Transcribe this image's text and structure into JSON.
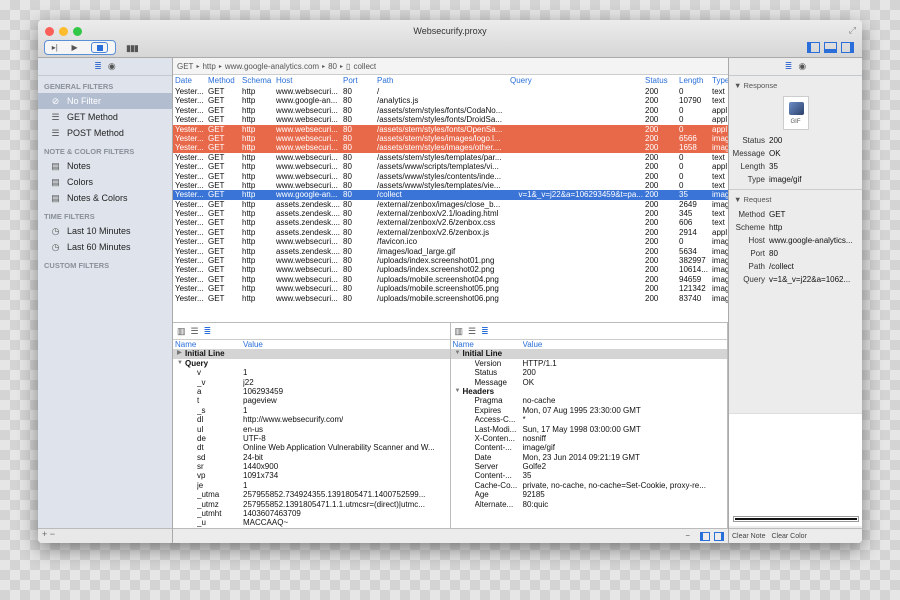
{
  "window": {
    "title": "Websecurify.proxy"
  },
  "sidebar": {
    "sections": [
      {
        "title": "GENERAL FILTERS",
        "items": [
          {
            "label": "No Filter",
            "icon": "no-filter-icon",
            "selected": true
          },
          {
            "label": "GET Method",
            "icon": "list-icon"
          },
          {
            "label": "POST Method",
            "icon": "list-icon"
          }
        ]
      },
      {
        "title": "NOTE & COLOR FILTERS",
        "items": [
          {
            "label": "Notes",
            "icon": "note-icon"
          },
          {
            "label": "Colors",
            "icon": "note-icon"
          },
          {
            "label": "Notes & Colors",
            "icon": "note-icon"
          }
        ]
      },
      {
        "title": "TIME FILTERS",
        "items": [
          {
            "label": "Last 10 Minutes",
            "icon": "clock-icon"
          },
          {
            "label": "Last 60 Minutes",
            "icon": "clock-icon"
          }
        ]
      },
      {
        "title": "CUSTOM FILTERS",
        "items": []
      }
    ],
    "footer": "+ −"
  },
  "breadcrumb": [
    "GET",
    "http",
    "www.google-analytics.com",
    "80",
    "collect"
  ],
  "table": {
    "columns": [
      "Date",
      "Method",
      "Schema",
      "Host",
      "Port",
      "Path",
      "Query",
      "Status",
      "Length",
      "Type"
    ],
    "rows": [
      [
        "Yester...",
        "GET",
        "http",
        "www.websecuri...",
        "80",
        "/",
        "",
        "200",
        "0",
        "text",
        "none"
      ],
      [
        "Yester...",
        "GET",
        "http",
        "www.google-an...",
        "80",
        "/analytics.js",
        "",
        "200",
        "10790",
        "text",
        "none"
      ],
      [
        "Yester...",
        "GET",
        "http",
        "www.websecuri...",
        "80",
        "/assets/stem/styles/fonts/CodaNo...",
        "",
        "200",
        "0",
        "appl",
        "none"
      ],
      [
        "Yester...",
        "GET",
        "http",
        "www.websecuri...",
        "80",
        "/assets/stem/styles/fonts/DroidSa...",
        "",
        "200",
        "0",
        "appl",
        "none"
      ],
      [
        "Yester...",
        "GET",
        "http",
        "www.websecuri...",
        "80",
        "/assets/stem/styles/fonts/OpenSa...",
        "",
        "200",
        "0",
        "appl",
        "red"
      ],
      [
        "Yester...",
        "GET",
        "http",
        "www.websecuri...",
        "80",
        "/assets/stem/styles/images/logo.l...",
        "",
        "200",
        "6566",
        "imag",
        "red"
      ],
      [
        "Yester...",
        "GET",
        "http",
        "www.websecuri...",
        "80",
        "/assets/stem/styles/images/other....",
        "",
        "200",
        "1658",
        "imag",
        "red"
      ],
      [
        "Yester...",
        "GET",
        "http",
        "www.websecuri...",
        "80",
        "/assets/stem/styles/templates/par...",
        "",
        "200",
        "0",
        "text",
        "none"
      ],
      [
        "Yester...",
        "GET",
        "http",
        "www.websecuri...",
        "80",
        "/assets/www/scripts/templates/vi...",
        "",
        "200",
        "0",
        "appl",
        "none"
      ],
      [
        "Yester...",
        "GET",
        "http",
        "www.websecuri...",
        "80",
        "/assets/www/styles/contents/inde...",
        "",
        "200",
        "0",
        "text",
        "none"
      ],
      [
        "Yester...",
        "GET",
        "http",
        "www.websecuri...",
        "80",
        "/assets/www/styles/templates/vie...",
        "",
        "200",
        "0",
        "text",
        "none"
      ],
      [
        "Yester...",
        "GET",
        "http",
        "www.google-an...",
        "80",
        "/collect",
        "v=1&_v=j22&a=106293459&t=pa...",
        "200",
        "35",
        "imag",
        "blue"
      ],
      [
        "Yester...",
        "GET",
        "http",
        "assets.zendesk....",
        "80",
        "/external/zenbox/images/close_b...",
        "",
        "200",
        "2649",
        "imag",
        "none"
      ],
      [
        "Yester...",
        "GET",
        "http",
        "assets.zendesk....",
        "80",
        "/external/zenbox/v2.1/loading.html",
        "",
        "200",
        "345",
        "text",
        "none"
      ],
      [
        "Yester...",
        "GET",
        "http",
        "assets.zendesk....",
        "80",
        "/external/zenbox/v2.6/zenbox.css",
        "",
        "200",
        "606",
        "text",
        "none"
      ],
      [
        "Yester...",
        "GET",
        "http",
        "assets.zendesk....",
        "80",
        "/external/zenbox/v2.6/zenbox.js",
        "",
        "200",
        "2914",
        "appl",
        "none"
      ],
      [
        "Yester...",
        "GET",
        "http",
        "www.websecuri...",
        "80",
        "/favicon.ico",
        "",
        "200",
        "0",
        "imag",
        "none"
      ],
      [
        "Yester...",
        "GET",
        "http",
        "assets.zendesk....",
        "80",
        "/images/load_large.gif",
        "",
        "200",
        "5634",
        "imag",
        "none"
      ],
      [
        "Yester...",
        "GET",
        "http",
        "www.websecuri...",
        "80",
        "/uploads/index.screenshot01.png",
        "",
        "200",
        "382997",
        "imag",
        "none"
      ],
      [
        "Yester...",
        "GET",
        "http",
        "www.websecuri...",
        "80",
        "/uploads/index.screenshot02.png",
        "",
        "200",
        "10614...",
        "imag",
        "none"
      ],
      [
        "Yester...",
        "GET",
        "http",
        "www.websecuri...",
        "80",
        "/uploads/mobile.screenshot04.png",
        "",
        "200",
        "94659",
        "imag",
        "none"
      ],
      [
        "Yester...",
        "GET",
        "http",
        "www.websecuri...",
        "80",
        "/uploads/mobile.screenshot05.png",
        "",
        "200",
        "121342",
        "imag",
        "none"
      ],
      [
        "Yester...",
        "GET",
        "http",
        "www.websecuri...",
        "80",
        "/uploads/mobile.screenshot06.png",
        "",
        "200",
        "83740",
        "imag",
        "none"
      ]
    ]
  },
  "request_pane": {
    "columns": [
      "Name",
      "Value"
    ],
    "groups": [
      {
        "title": "Initial Line",
        "expanded": false,
        "rows": []
      },
      {
        "title": "Query",
        "expanded": true,
        "rows": [
          [
            "v",
            "1"
          ],
          [
            "_v",
            "j22"
          ],
          [
            "a",
            "106293459"
          ],
          [
            "t",
            "pageview"
          ],
          [
            "_s",
            "1"
          ],
          [
            "dl",
            "http://www.websecurify.com/"
          ],
          [
            "ul",
            "en-us"
          ],
          [
            "de",
            "UTF-8"
          ],
          [
            "dt",
            "Online Web Application Vulnerability Scanner and W..."
          ],
          [
            "sd",
            "24-bit"
          ],
          [
            "sr",
            "1440x900"
          ],
          [
            "vp",
            "1091x734"
          ],
          [
            "je",
            "1"
          ],
          [
            "_utma",
            "257955852.734924355.1391805471.1400752599..."
          ],
          [
            "_utmz",
            "257955852.1391805471.1.1.utmcsr=(direct)|utmc..."
          ],
          [
            "_utmht",
            "1403607463709"
          ],
          [
            "_u",
            "MACCAAQ~"
          ]
        ]
      }
    ]
  },
  "response_pane": {
    "columns": [
      "Name",
      "Value"
    ],
    "groups": [
      {
        "title": "Initial Line",
        "expanded": true,
        "rows": [
          [
            "Version",
            "HTTP/1.1"
          ],
          [
            "Status",
            "200"
          ],
          [
            "Message",
            "OK"
          ]
        ]
      },
      {
        "title": "Headers",
        "expanded": true,
        "rows": [
          [
            "Pragma",
            "no-cache"
          ],
          [
            "Expires",
            "Mon, 07 Aug 1995 23:30:00 GMT"
          ],
          [
            "Access-C...",
            "*"
          ],
          [
            "Last-Modi...",
            "Sun, 17 May 1998 03:00:00 GMT"
          ],
          [
            "X-Conten...",
            "nosniff"
          ],
          [
            "Content-...",
            "image/gif"
          ],
          [
            "Date",
            "Mon, 23 Jun 2014 09:21:19 GMT"
          ],
          [
            "Server",
            "Golfe2"
          ],
          [
            "Content-...",
            "35"
          ],
          [
            "Cache-Co...",
            "private, no-cache, no-cache=Set-Cookie, proxy-re..."
          ],
          [
            "Age",
            "92185"
          ],
          [
            "Alternate...",
            "80:quic"
          ]
        ]
      }
    ]
  },
  "inspector": {
    "response": {
      "title": "Response",
      "icon_label": "GIF",
      "fields": [
        [
          "Status",
          "200"
        ],
        [
          "Message",
          "OK"
        ],
        [
          "Length",
          "35"
        ],
        [
          "Type",
          "image/gif"
        ]
      ]
    },
    "request": {
      "title": "Request",
      "fields": [
        [
          "Method",
          "GET"
        ],
        [
          "Scheme",
          "http"
        ],
        [
          "Host",
          "www.google-analytics..."
        ],
        [
          "Port",
          "80"
        ],
        [
          "Path",
          "/collect"
        ],
        [
          "Query",
          "v=1&_v=j22&a=1062..."
        ]
      ]
    },
    "clear_note": "Clear Note",
    "clear_color": "Clear Color"
  },
  "colors": {
    "highlight_red": "#e8684a",
    "selection_blue": "#3a74d6",
    "accent": "#2a6fd9"
  }
}
